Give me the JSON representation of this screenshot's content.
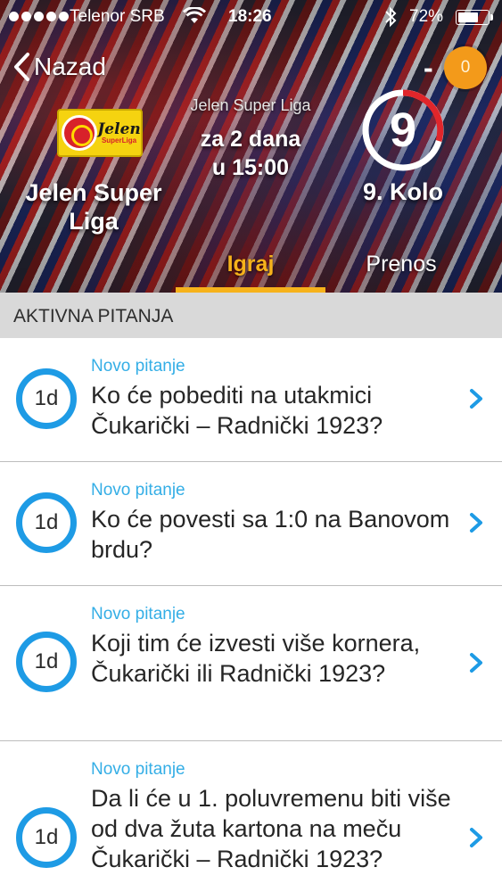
{
  "status_bar": {
    "carrier": "Telenor SRB",
    "time": "18:26",
    "battery_percent": "72%",
    "battery_level": 0.72,
    "signal_bars": 5,
    "icons": [
      "signal-dots-icon",
      "wifi-icon",
      "bluetooth-icon",
      "battery-icon"
    ]
  },
  "nav": {
    "back_label": "Nazad",
    "score_dash": "-",
    "coins": "0"
  },
  "hero": {
    "league_logo": {
      "brand": "Jelen",
      "sub": "SuperLiga"
    },
    "league_name": "Jelen Super Liga",
    "subtitle": "Jelen Super Liga",
    "when_line1": "za 2 dana",
    "when_line2": "u 15:00",
    "round_number": "9",
    "round_label": "9. Kolo"
  },
  "tabs": [
    {
      "label": "Igraj",
      "active": true
    },
    {
      "label": "Prenos",
      "active": false
    }
  ],
  "section_title": "AKTIVNA PITANJA",
  "questions": [
    {
      "time_left": "1d",
      "tag": "Novo pitanje",
      "text": "Ko će pobediti na utakmici Čukarički – Radnički 1923?"
    },
    {
      "time_left": "1d",
      "tag": "Novo pitanje",
      "text": "Ko će povesti sa 1:0 na Banovom brdu?"
    },
    {
      "time_left": "1d",
      "tag": "Novo pitanje",
      "text": "Koji tim će izvesti više kornera, Čukarički ili Radnički 1923?"
    },
    {
      "time_left": "1d",
      "tag": "Novo pitanje",
      "text": "Da li će u 1. poluvremenu biti više od dva žuta kartona na meču Čukarički – Radnički 1923?"
    }
  ],
  "colors": {
    "accent_orange": "#f6b21b",
    "coin_orange": "#f39a1a",
    "ring_blue": "#1e9be5",
    "tag_blue": "#34aee6",
    "round_red": "#e0262b"
  }
}
